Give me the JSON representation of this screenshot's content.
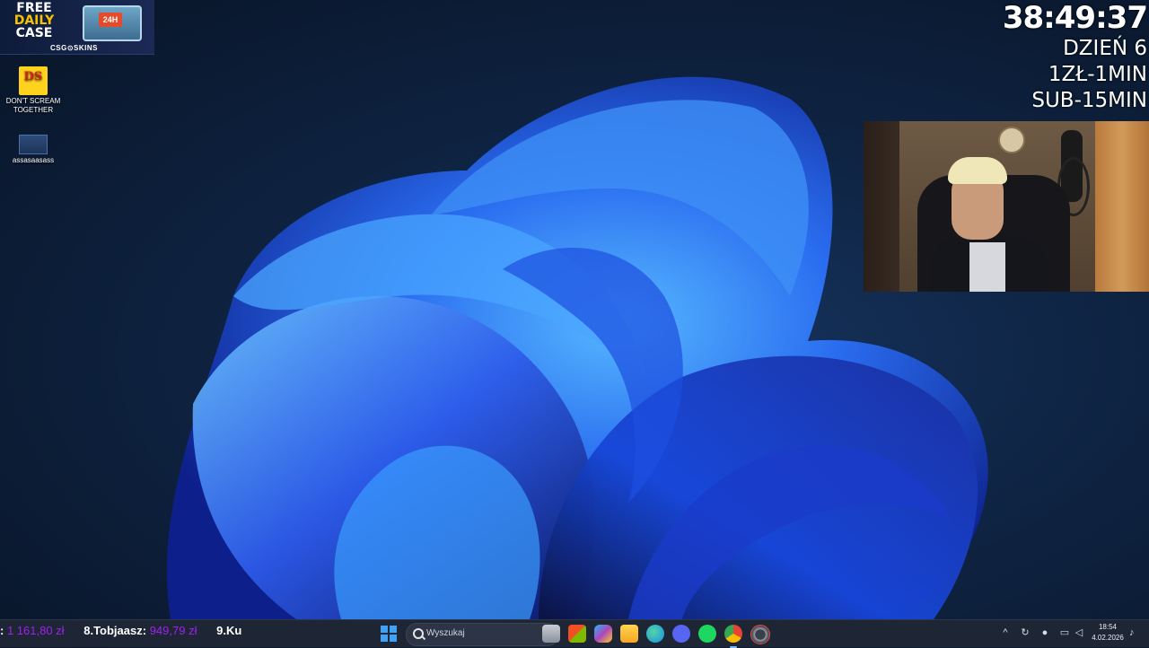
{
  "promo": {
    "line1": "FREE",
    "line2": "DAILY",
    "line3": "CASE",
    "badge": "24H",
    "brand": "CSG⊙SKINS"
  },
  "desktop_icons": [
    {
      "label": "DON'T SCREAM TOGETHER",
      "glyph": "DS",
      "icon": "dont-scream-together-icon"
    },
    {
      "label": "assasaasass",
      "icon": "file-icon"
    }
  ],
  "overlay": {
    "timer": "38:49:37",
    "day": "DZIEŃ 6",
    "rate": "1ZŁ-1MIN",
    "sub": "SUB-15MIN"
  },
  "taskbar": {
    "ticker": [
      {
        "idx": "",
        "name": "",
        "amount": "1 161,80 zł"
      },
      {
        "idx": "8.",
        "name": "Tobjaasz:",
        "amount": "949,79 zł"
      },
      {
        "idx": "9.",
        "name": "Ku",
        "amount": ""
      }
    ],
    "search_placeholder": "Wyszukaj",
    "apps": [
      "task-view-icon",
      "store-icon",
      "copilot-icon",
      "file-explorer-icon",
      "edge-icon",
      "discord-icon",
      "spotify-icon",
      "chrome-icon",
      "settings-icon"
    ],
    "time": "18:54",
    "date": "4.02.2026"
  },
  "colors": {
    "accent": "#3ea3f5",
    "ticker_amount": "#a020f0",
    "timer_text": "#ffffff"
  }
}
